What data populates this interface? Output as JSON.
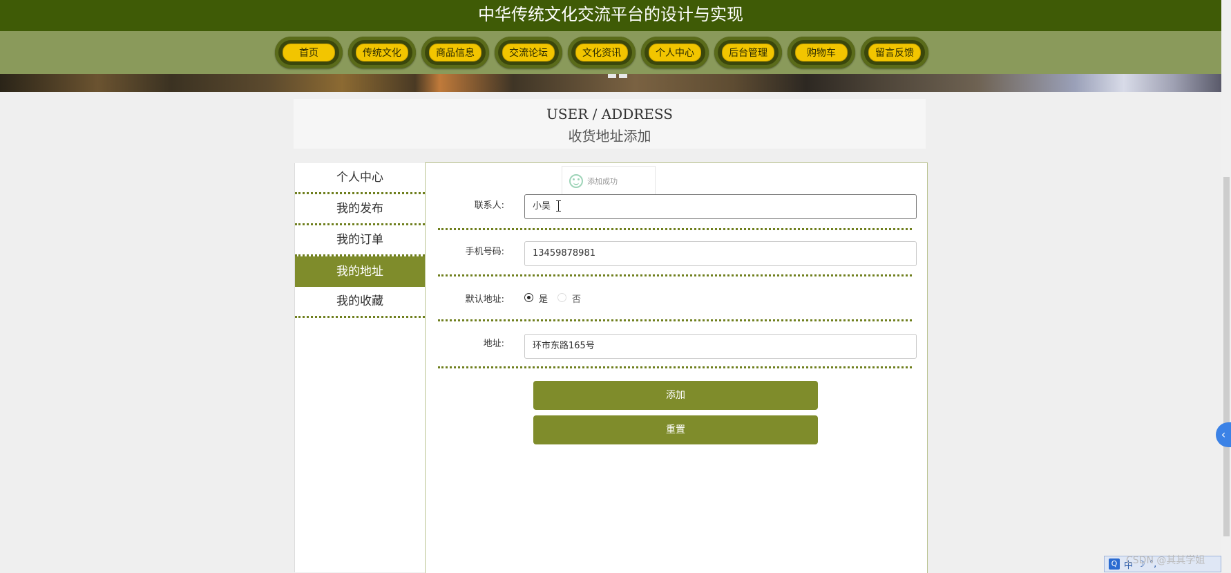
{
  "header": {
    "title": "中华传统文化交流平台的设计与实现"
  },
  "nav": {
    "items": [
      {
        "label": "首页"
      },
      {
        "label": "传统文化"
      },
      {
        "label": "商品信息"
      },
      {
        "label": "交流论坛"
      },
      {
        "label": "文化资讯"
      },
      {
        "label": "个人中心"
      },
      {
        "label": "后台管理"
      },
      {
        "label": "购物车"
      },
      {
        "label": "留言反馈"
      }
    ]
  },
  "section": {
    "title_en": "USER / ADDRESS",
    "title_zh": "收货地址添加"
  },
  "sidebar": {
    "items": [
      {
        "label": "个人中心",
        "active": false
      },
      {
        "label": "我的发布",
        "active": false
      },
      {
        "label": "我的订单",
        "active": false
      },
      {
        "label": "我的地址",
        "active": true
      },
      {
        "label": "我的收藏",
        "active": false
      }
    ]
  },
  "toast": {
    "message": "添加成功",
    "icon": "smile-icon"
  },
  "form": {
    "contact": {
      "label": "联系人:",
      "value": "小吴"
    },
    "phone": {
      "label": "手机号码:",
      "value": "13459878981"
    },
    "default_address": {
      "label": "默认地址:",
      "option_yes": "是",
      "option_no": "否",
      "selected": "是"
    },
    "address": {
      "label": "地址:",
      "value": "环市东路165号"
    },
    "add_button": "添加",
    "reset_button": "重置"
  },
  "overlay": {
    "watermark": "CSDN @其其学姐",
    "ime_label": "中"
  },
  "colors": {
    "title_bar": "#3f5b06",
    "nav_strip": "#8a9a5b",
    "accent": "#7f8c2b",
    "nav_pill": "#f2c500"
  }
}
